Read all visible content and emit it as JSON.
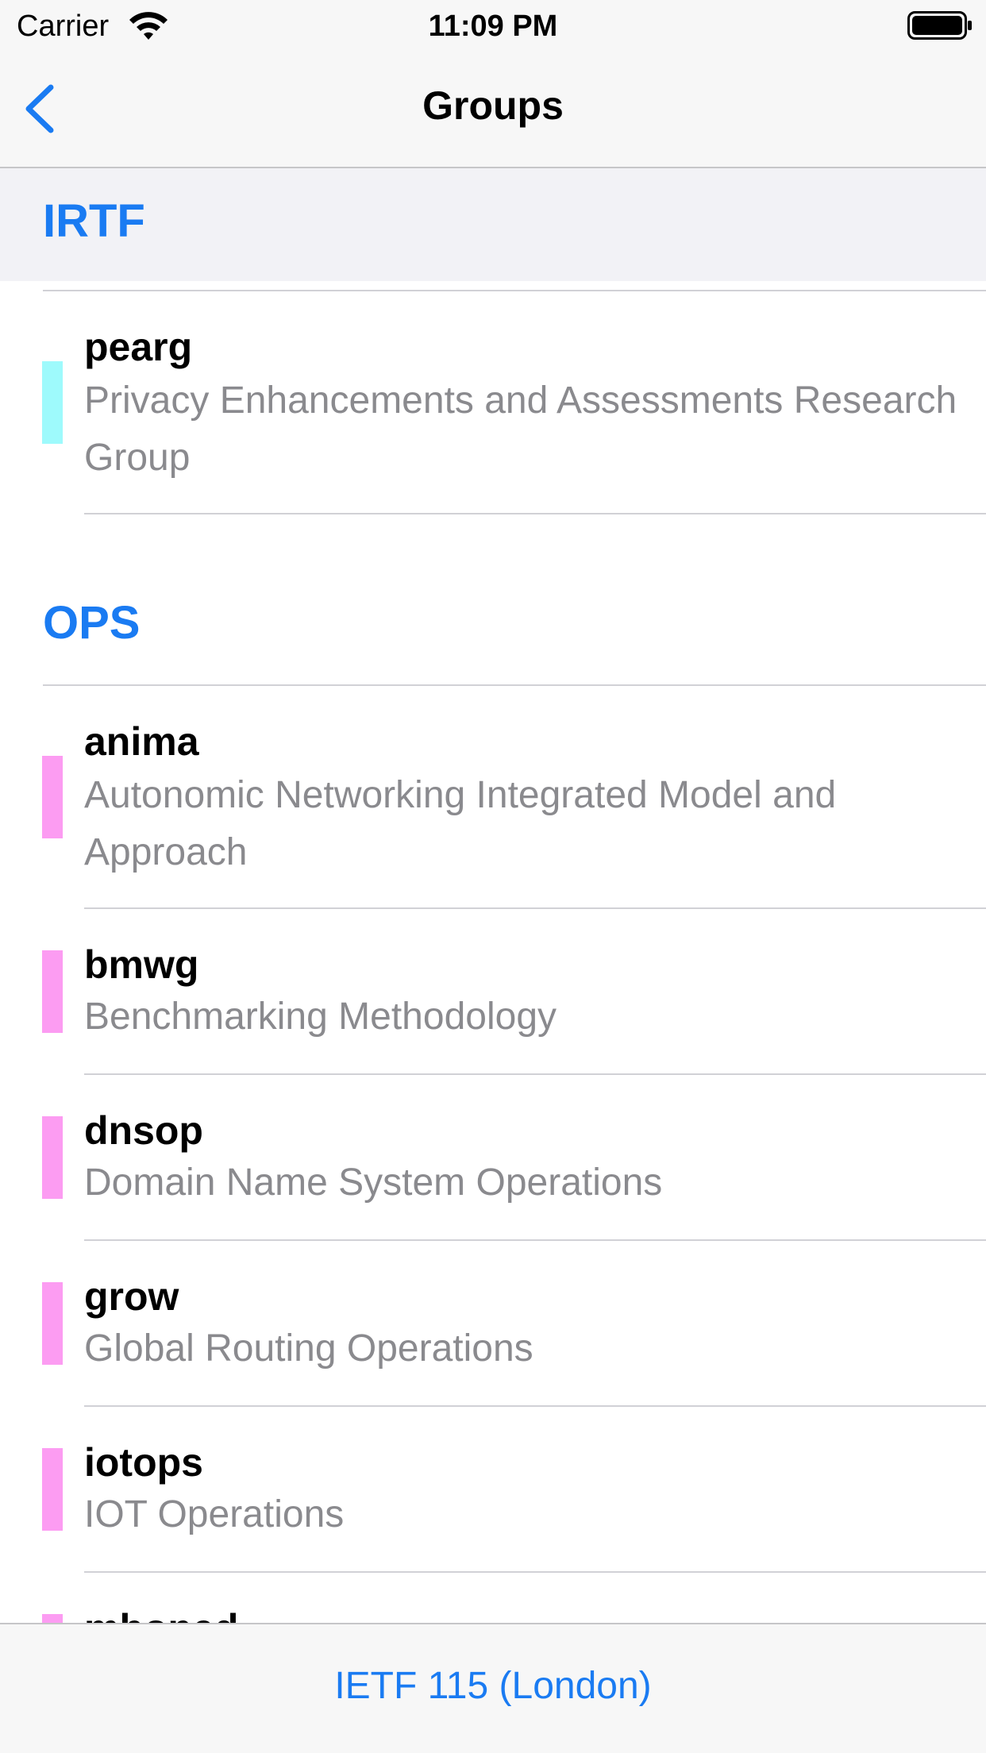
{
  "status_bar": {
    "carrier": "Carrier",
    "time": "11:09 PM"
  },
  "nav": {
    "title": "Groups",
    "back_icon": "chevron-left-icon"
  },
  "colors": {
    "accent": "#1a7bf2",
    "irtf_group": "#9efafc",
    "ops_group": "#fc9cf2"
  },
  "sections": [
    {
      "title": "IRTF",
      "groups": [
        {
          "name": "pearg",
          "description": "Privacy Enhancements and Assessments Research Group"
        }
      ]
    },
    {
      "title": "OPS",
      "groups": [
        {
          "name": "anima",
          "description": "Autonomic Networking Integrated Model and Approach"
        },
        {
          "name": "bmwg",
          "description": "Benchmarking Methodology"
        },
        {
          "name": "dnsop",
          "description": "Domain Name System Operations"
        },
        {
          "name": "grow",
          "description": "Global Routing Operations"
        },
        {
          "name": "iotops",
          "description": "IOT Operations"
        },
        {
          "name": "mboned",
          "description": ""
        }
      ]
    }
  ],
  "toolbar": {
    "meeting_label": "IETF 115 (London)"
  }
}
